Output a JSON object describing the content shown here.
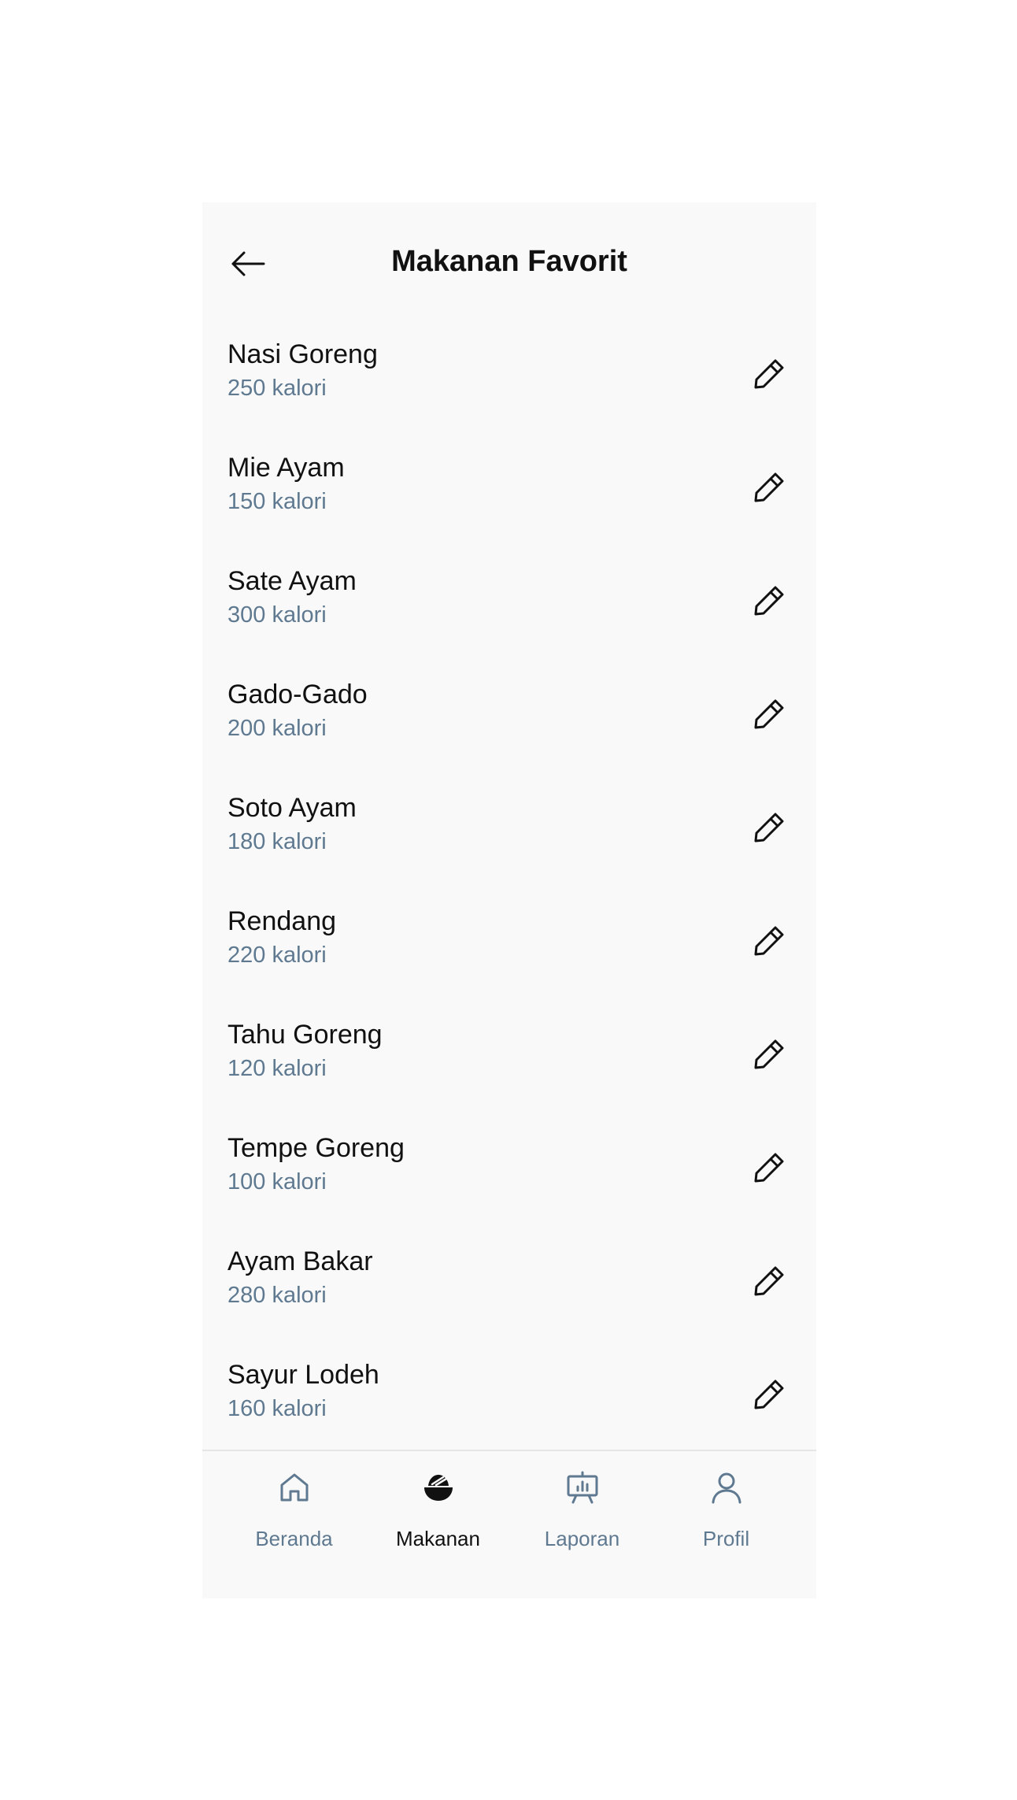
{
  "header": {
    "title": "Makanan Favorit",
    "back_icon": "arrow-left-icon"
  },
  "foods": [
    {
      "name": "Nasi Goreng",
      "calories": "250 kalori"
    },
    {
      "name": "Mie Ayam",
      "calories": "150 kalori"
    },
    {
      "name": "Sate Ayam",
      "calories": "300 kalori"
    },
    {
      "name": "Gado-Gado",
      "calories": "200 kalori"
    },
    {
      "name": "Soto Ayam",
      "calories": "180 kalori"
    },
    {
      "name": "Rendang",
      "calories": "220 kalori"
    },
    {
      "name": "Tahu Goreng",
      "calories": "120 kalori"
    },
    {
      "name": "Tempe Goreng",
      "calories": "100 kalori"
    },
    {
      "name": "Ayam Bakar",
      "calories": "280 kalori"
    },
    {
      "name": "Sayur Lodeh",
      "calories": "160 kalori"
    }
  ],
  "edit_icon": "pencil-icon",
  "nav": {
    "active": "Makanan",
    "items": [
      {
        "label": "Beranda",
        "icon": "home-icon"
      },
      {
        "label": "Makanan",
        "icon": "food-bowl-icon"
      },
      {
        "label": "Laporan",
        "icon": "presentation-chart-icon"
      },
      {
        "label": "Profil",
        "icon": "user-icon"
      }
    ]
  },
  "colors": {
    "background": "#f9f9f9",
    "text_primary": "#111111",
    "text_secondary": "#5e7990",
    "divider": "#e6e6e6"
  }
}
